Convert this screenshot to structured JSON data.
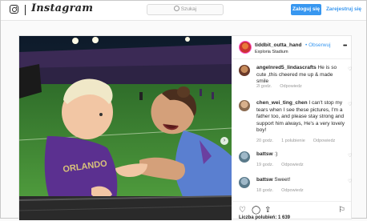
{
  "nav": {
    "logo_text": "Instagram",
    "search_placeholder": "Szukaj",
    "login_label": "Zaloguj się",
    "signup_label": "Zarejestruj się"
  },
  "post": {
    "author": "tiddbit_outta_hand",
    "follow_label": "Obserwuj",
    "location": "Exploria Stadium",
    "comments": [
      {
        "user": "angelnred5_lindascrafts",
        "text": "He is so cute ,this cheered me up & made smile",
        "time": "2l godz.",
        "reply": "Odpowiedz",
        "likes": ""
      },
      {
        "user": "chen_wei_ting_chen",
        "text": "I can't stop my tears when I see these pictures, I'm a father too, and please stay strong and support him always, He's a very lovely boy!",
        "time": "20 godz.",
        "likes": "1 polubienie",
        "reply": "Odpowiedz"
      },
      {
        "user": "battsw",
        "text": ":)",
        "time": "19 godz.",
        "reply": "Odpowiedz",
        "likes": ""
      },
      {
        "user": "battsw",
        "text": "Sweet!",
        "time": "18 godz.",
        "reply": "Odpowiedz",
        "likes": ""
      }
    ],
    "likes_text": "Liczba polubień: 1 639"
  },
  "colors": {
    "accent": "#3897f0",
    "text": "#262626",
    "muted": "#999999"
  }
}
